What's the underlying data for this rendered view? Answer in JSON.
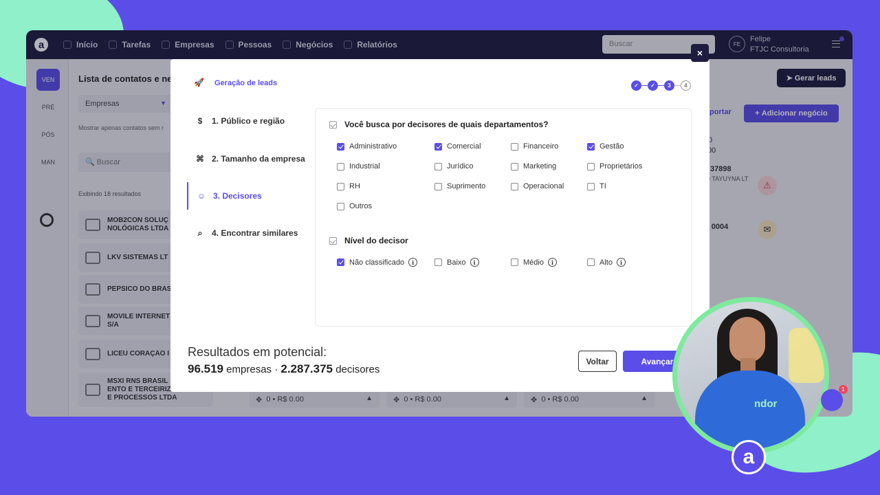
{
  "nav": {
    "items": [
      "Início",
      "Tarefas",
      "Empresas",
      "Pessoas",
      "Negócios",
      "Relatórios"
    ],
    "search_placeholder": "Buscar",
    "user_initials": "FE",
    "user_name": "Felipe",
    "user_company": "FTJC Consultoria"
  },
  "rail": {
    "items": [
      "VEN",
      "PRÉ",
      "PÓS",
      "MAN"
    ]
  },
  "list": {
    "title": "Lista de contatos e neg",
    "dropdown": "Empresas",
    "note": "Mostrar apenas contatos sem r",
    "search_placeholder": "Buscar",
    "count": "Exibindo 18 resultados",
    "companies": [
      "MOB2CON SOLUÇ\nNOLÓGICAS LTDA",
      "LKV SISTEMAS LT",
      "PEPSICO DO BRAS",
      "MOVILE INTERNET\nS/A",
      "LICEU CORAÇÃO I",
      "MSXI RNS BRASIL\nENTO E TERCEIRIZ\nE PROCESSOS LTDA"
    ]
  },
  "background": {
    "gerar_leads": "Gerar leads",
    "exportar": "portar",
    "adicionar_negocio": "Adicionar negócio",
    "zero": "0",
    "zero_money": ".00",
    "deal1_id": "37898",
    "deal1_name": "O TAYUYNA LT",
    "deal2_id": "- 0004",
    "stage_values": [
      "0 • R$ 0.00",
      "0 • R$ 0.00",
      "0 • R$ 0.00"
    ]
  },
  "modal": {
    "header": "Geração de leads",
    "close": "×",
    "stepper": {
      "current": "3",
      "next": "4"
    },
    "steps": [
      {
        "label": "1. Público e região",
        "icon": "$"
      },
      {
        "label": "2. Tamanho da empresa",
        "icon": "⌘"
      },
      {
        "label": "3. Decisores",
        "icon": "☺"
      },
      {
        "label": "4. Encontrar similares",
        "icon": "⌕"
      }
    ],
    "q1": "Você busca por decisores de quais departamentos?",
    "departments": [
      {
        "label": "Administrativo",
        "checked": true
      },
      {
        "label": "Comercial",
        "checked": true
      },
      {
        "label": "Financeiro",
        "checked": false
      },
      {
        "label": "Gestão",
        "checked": true
      },
      {
        "label": "Industrial",
        "checked": false
      },
      {
        "label": "Jurídico",
        "checked": false
      },
      {
        "label": "Marketing",
        "checked": false
      },
      {
        "label": "Proprietários",
        "checked": false
      },
      {
        "label": "RH",
        "checked": false
      },
      {
        "label": "Suprimento",
        "checked": false
      },
      {
        "label": "Operacional",
        "checked": false
      },
      {
        "label": "TI",
        "checked": false
      },
      {
        "label": "Outros",
        "checked": false
      }
    ],
    "q2": "Nível do decisor",
    "levels": [
      {
        "label": "Não classificado",
        "checked": true
      },
      {
        "label": "Baixo",
        "checked": false
      },
      {
        "label": "Médio",
        "checked": false
      },
      {
        "label": "Alto",
        "checked": false
      }
    ],
    "info_glyph": "i",
    "results_label": "Resultados em potencial:",
    "results_companies": "96.519",
    "results_companies_unit": "empresas",
    "results_sep": "·",
    "results_decisores": "2.287.375",
    "results_decisores_unit": "decisores",
    "btn_back": "Voltar",
    "btn_next": "Avançar"
  },
  "presenter": {
    "shirt_text": "ndor",
    "badge": "a",
    "chat_count": "1"
  },
  "colors": {
    "accent": "#5b4de8",
    "dark": "#1e1d3f",
    "mint": "#8ff0c9"
  }
}
